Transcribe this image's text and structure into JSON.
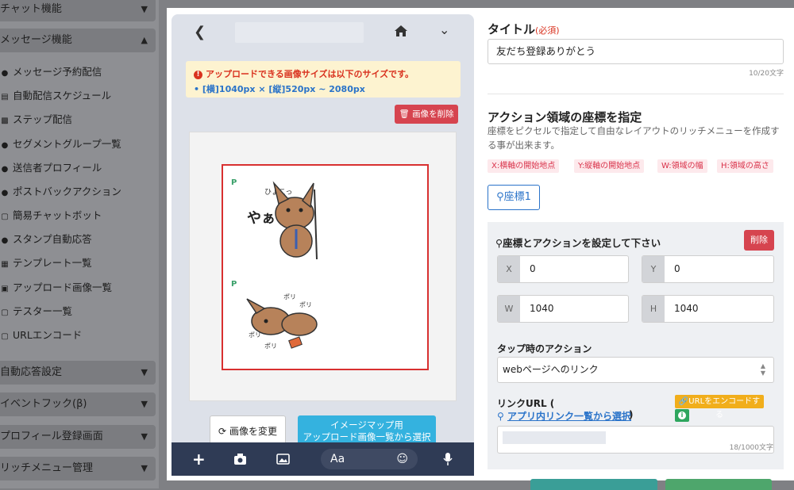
{
  "sidebar": {
    "sections": [
      {
        "label": "チャット機能",
        "chevron": "down"
      },
      {
        "label": "メッセージ機能",
        "chevron": "up"
      },
      {
        "label": "自動応答設定",
        "chevron": "down"
      },
      {
        "label": "イベントフック(β)",
        "chevron": "down"
      },
      {
        "label": "プロフィール登録画面",
        "chevron": "down"
      },
      {
        "label": "リッチメニュー管理",
        "chevron": "down"
      }
    ],
    "items": [
      {
        "label": "メッセージ予約配信",
        "icon": "send-icon"
      },
      {
        "label": "自動配信スケジュール",
        "icon": "calendar-icon"
      },
      {
        "label": "ステップ配信",
        "icon": "steps-icon"
      },
      {
        "label": "セグメントグループ一覧",
        "icon": "users-icon"
      },
      {
        "label": "送信者プロフィール",
        "icon": "profile-icon"
      },
      {
        "label": "ポストバックアクション",
        "icon": "postback-icon"
      },
      {
        "label": "簡易チャットボット",
        "icon": "bot-icon"
      },
      {
        "label": "スタンプ自動応答",
        "icon": "stamp-icon"
      },
      {
        "label": "テンプレート一覧",
        "icon": "template-icon"
      },
      {
        "label": "アップロード画像一覧",
        "icon": "image-icon"
      },
      {
        "label": "テスター一覧",
        "icon": "tester-icon"
      },
      {
        "label": "URLエンコード",
        "icon": "link-icon"
      }
    ]
  },
  "phone": {
    "notice_warning": "アップロードできる画像サイズは以下のサイズです。",
    "notice_size": "• [横]1040px × [縦]520px ~ 2080px",
    "delete_image_label": "画像を削除",
    "sticker_top_text": "ひょこっ",
    "sticker_top_word": "やぁ",
    "sticker_bottom_text": "ポリ",
    "change_image_label": "画像を変更",
    "imagemap_button_line1": "イメージマップ用",
    "imagemap_button_line2": "アップロード画像一覧から選択",
    "input_placeholder": "Aa"
  },
  "form": {
    "title_label": "タイトル",
    "required_label": "(必須)",
    "title_value": "友だち登録ありがとう",
    "title_count": "10/20文字",
    "coords_heading": "アクション領域の座標を指定",
    "coords_desc": "座標をピクセルで指定して自由なレイアウトのリッチメニューを作成する事が出来ます。",
    "tags": [
      "X:横軸の開始地点",
      "Y:縦軸の開始地点",
      "W:領域の幅",
      "H:領域の高さ"
    ],
    "coord_tab": "座標1",
    "action_heading": "座標とアクションを設定して下さい",
    "delete_label": "削除",
    "x_label": "X",
    "x_value": "0",
    "y_label": "Y",
    "y_value": "0",
    "w_label": "W",
    "w_value": "1040",
    "h_label": "H",
    "h_value": "1040",
    "tap_action_label": "タップ時のアクション",
    "tap_action_value": "webページへのリンク",
    "link_url_label": "リンクURL (",
    "link_select": "アプリ内リンク一覧から選択",
    "link_paren_close": ")",
    "encode_button": "URLをエンコードする",
    "url_count": "18/1000文字"
  },
  "colors": {
    "accent_blue": "#2a73c9",
    "danger_red": "#d6444f",
    "phone_bar": "#2f3b55",
    "warning_bg": "#fdf3d0",
    "encode_orange": "#f1ae1b"
  }
}
